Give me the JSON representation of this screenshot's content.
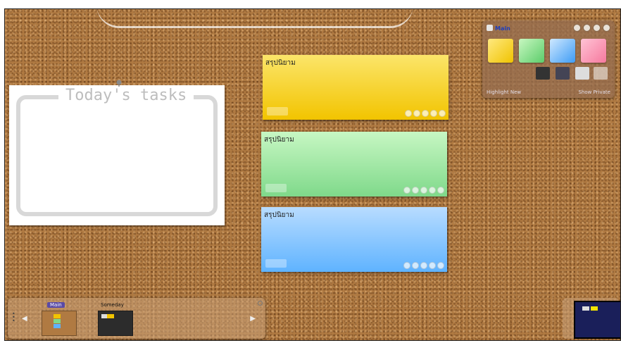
{
  "tasks_card": {
    "title": "Today's tasks"
  },
  "notes": [
    {
      "title": "สรุปนิยาม",
      "color": "#f2c400"
    },
    {
      "title": "สรุปนิยาม",
      "color": "#7fd98a"
    },
    {
      "title": "สรุปนิยาม",
      "color": "#5fb3ff"
    }
  ],
  "panel": {
    "title": "Main",
    "highlight_label": "Highlight New",
    "private_label": "Show Private"
  },
  "dock": {
    "boards": [
      {
        "label": "Main"
      },
      {
        "label": "Someday"
      }
    ]
  }
}
